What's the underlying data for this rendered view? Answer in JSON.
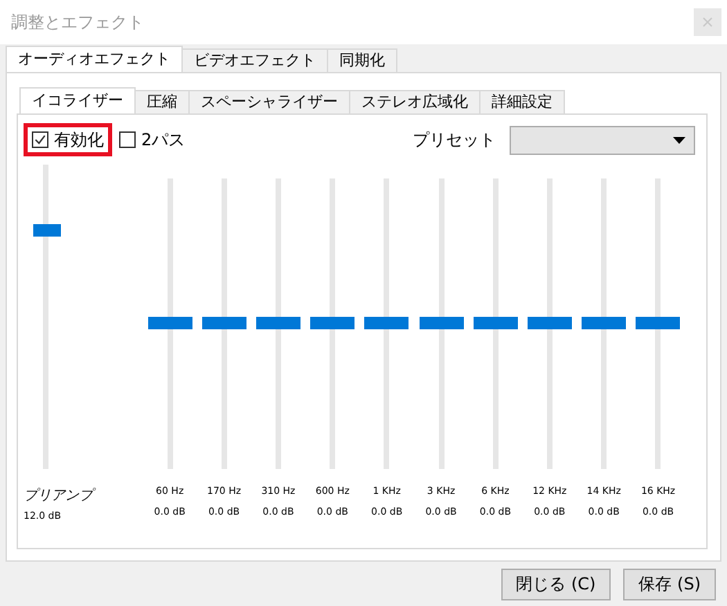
{
  "window": {
    "title": "調整とエフェクト"
  },
  "tabs": [
    {
      "label": "オーディオエフェクト",
      "selected": true
    },
    {
      "label": "ビデオエフェクト",
      "selected": false
    },
    {
      "label": "同期化",
      "selected": false
    }
  ],
  "subtabs": [
    {
      "label": "イコライザー",
      "selected": true
    },
    {
      "label": "圧縮",
      "selected": false
    },
    {
      "label": "スペーシャライザー",
      "selected": false
    },
    {
      "label": "ステレオ広域化",
      "selected": false
    },
    {
      "label": "詳細設定",
      "selected": false
    }
  ],
  "enable": {
    "label": "有効化",
    "checked": true,
    "highlighted": true
  },
  "two_pass": {
    "label": "2パス",
    "checked": false
  },
  "preset": {
    "label": "プリセット"
  },
  "preamp": {
    "label": "プリアンプ",
    "reading": "12.0 dB",
    "level": 0.78
  },
  "bands": [
    {
      "frequency": "60 Hz",
      "reading": "0.0 dB",
      "level": 0.5
    },
    {
      "frequency": "170 Hz",
      "reading": "0.0 dB",
      "level": 0.5
    },
    {
      "frequency": "310 Hz",
      "reading": "0.0 dB",
      "level": 0.5
    },
    {
      "frequency": "600 Hz",
      "reading": "0.0 dB",
      "level": 0.5
    },
    {
      "frequency": "1 KHz",
      "reading": "0.0 dB",
      "level": 0.5
    },
    {
      "frequency": "3 KHz",
      "reading": "0.0 dB",
      "level": 0.5
    },
    {
      "frequency": "6 KHz",
      "reading": "0.0 dB",
      "level": 0.5
    },
    {
      "frequency": "12 KHz",
      "reading": "0.0 dB",
      "level": 0.5
    },
    {
      "frequency": "14 KHz",
      "reading": "0.0 dB",
      "level": 0.5
    },
    {
      "frequency": "16 KHz",
      "reading": "0.0 dB",
      "level": 0.5
    }
  ],
  "buttons": [
    "閉じる (C)",
    "保存 (S)"
  ]
}
